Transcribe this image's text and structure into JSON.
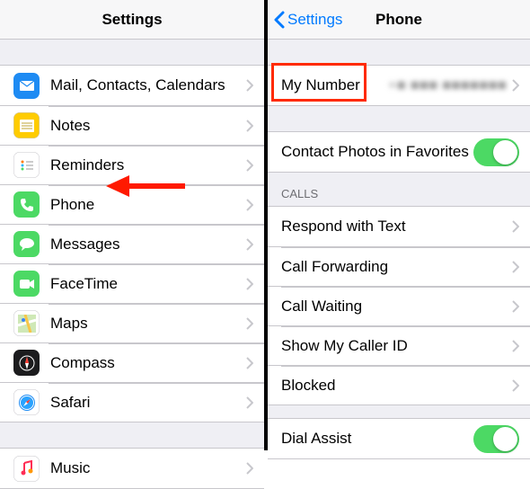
{
  "left": {
    "title": "Settings",
    "groups": [
      [
        {
          "icon": "mail",
          "bg": "#1e8bf3",
          "label": "Mail, Contacts, Calendars"
        },
        {
          "icon": "notes",
          "bg": "#ffcc00",
          "label": "Notes"
        },
        {
          "icon": "reminders",
          "bg": "#ffffff",
          "label": "Reminders"
        },
        {
          "icon": "phone",
          "bg": "#4cd964",
          "label": "Phone"
        },
        {
          "icon": "messages",
          "bg": "#4cd964",
          "label": "Messages"
        },
        {
          "icon": "facetime",
          "bg": "#4cd964",
          "label": "FaceTime"
        },
        {
          "icon": "maps",
          "bg": "#ffffff",
          "label": "Maps"
        },
        {
          "icon": "compass",
          "bg": "#1c1c1e",
          "label": "Compass"
        },
        {
          "icon": "safari",
          "bg": "#ffffff",
          "label": "Safari"
        }
      ],
      [
        {
          "icon": "music",
          "bg": "#ffffff",
          "label": "Music"
        }
      ]
    ]
  },
  "right": {
    "back": "Settings",
    "title": "Phone",
    "myNumber": {
      "label": "My Number",
      "value": "+■ ■■■ ■■■■■■■"
    },
    "contactPhotos": {
      "label": "Contact Photos in Favorites",
      "on": true
    },
    "callsHeader": "CALLS",
    "calls": [
      {
        "label": "Respond with Text"
      },
      {
        "label": "Call Forwarding"
      },
      {
        "label": "Call Waiting"
      },
      {
        "label": "Show My Caller ID"
      },
      {
        "label": "Blocked"
      }
    ],
    "dialAssist": {
      "label": "Dial Assist",
      "on": true
    }
  }
}
